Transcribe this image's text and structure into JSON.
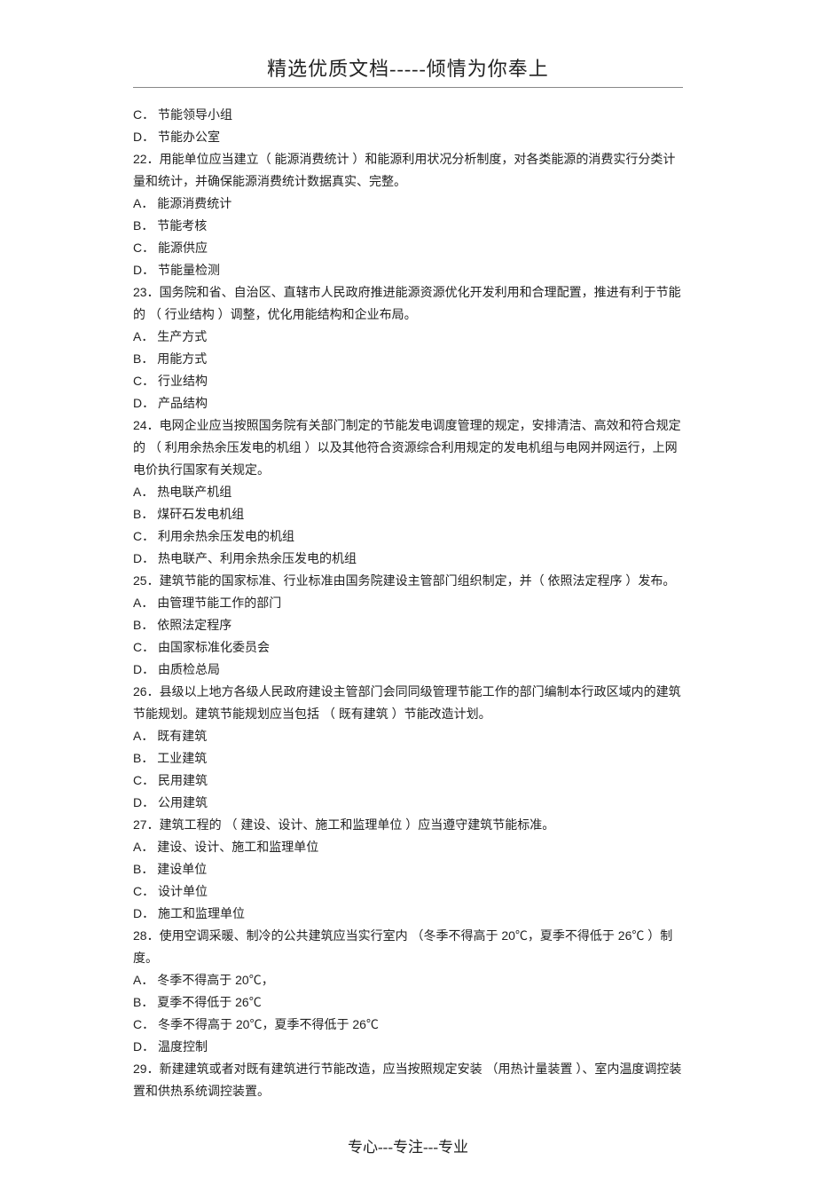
{
  "header": "精选优质文档-----倾情为你奉上",
  "footer": "专心---专注---专业",
  "lines": [
    "C．  节能领导小组",
    "D．  节能办公室",
    "22．用能单位应当建立（ 能源消费统计 ）和能源利用状况分析制度，对各类能源的消费实行分类计量和统计，并确保能源消费统计数据真实、完整。",
    "A．  能源消费统计",
    "B．  节能考核",
    "C．  能源供应",
    "D．  节能量检测",
    "23．国务院和省、自治区、直辖市人民政府推进能源资源优化开发利用和合理配置，推进有利于节能的 （ 行业结构 ）调整，优化用能结构和企业布局。",
    "A．  生产方式",
    "B．  用能方式",
    "C．  行业结构",
    "D．  产品结构",
    "24．电网企业应当按照国务院有关部门制定的节能发电调度管理的规定，安排清洁、高效和符合规定的 （ 利用余热余压发电的机组 ）以及其他符合资源综合利用规定的发电机组与电网并网运行，上网电价执行国家有关规定。",
    "A．  热电联产机组",
    "B．  煤矸石发电机组",
    "C．  利用余热余压发电的机组",
    "D．  热电联产、利用余热余压发电的机组",
    "25．建筑节能的国家标准、行业标准由国务院建设主管部门组织制定，并（ 依照法定程序 ）发布。",
    "A．  由管理节能工作的部门",
    "B．  依照法定程序",
    "C．  由国家标准化委员会",
    "D．  由质检总局",
    "26．县级以上地方各级人民政府建设主管部门会同同级管理节能工作的部门编制本行政区域内的建筑节能规划。建筑节能规划应当包括 （ 既有建筑 ）节能改造计划。",
    "A．  既有建筑",
    "B．  工业建筑",
    "C．  民用建筑",
    "D．  公用建筑",
    "27．建筑工程的 （ 建设、设计、施工和监理单位 ）应当遵守建筑节能标准。",
    "A．  建设、设计、施工和监理单位",
    "B．  建设单位",
    "C．  设计单位",
    "D．  施工和监理单位",
    "28．使用空调采暖、制冷的公共建筑应当实行室内 （冬季不得高于 20℃，夏季不得低于 26℃ ）制度。",
    "A．  冬季不得高于 20℃，",
    "B．  夏季不得低于 26℃",
    "C．  冬季不得高于 20℃，夏季不得低于 26℃",
    "D．  温度控制",
    "29．新建建筑或者对既有建筑进行节能改造，应当按照规定安装 （用热计量装置 ）、室内温度调控装置和供热系统调控装置。"
  ]
}
